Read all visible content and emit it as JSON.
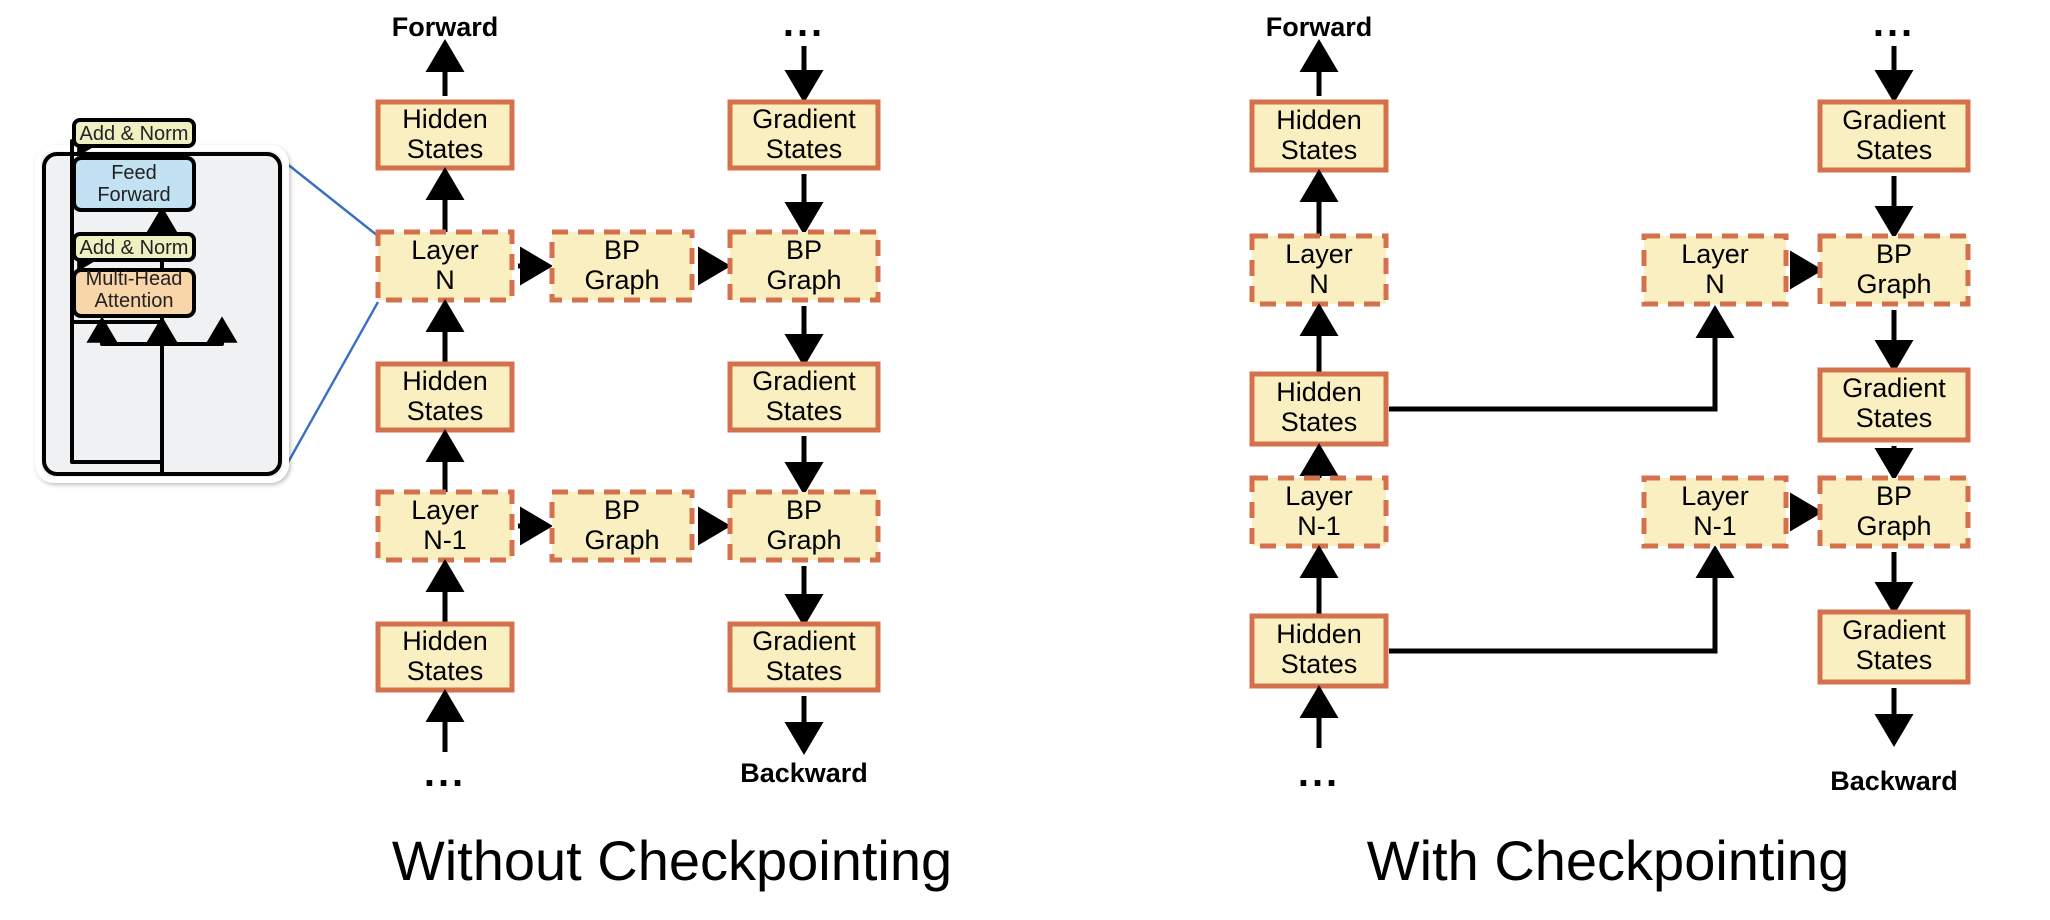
{
  "colors": {
    "box_fill": "#FAEFC0",
    "box_border": "#D4714C",
    "arrow": "#000000",
    "connector_blue": "#3B6FC4",
    "inset_bg": "#F0F1F2",
    "inset_border": "#000000",
    "addnorm_fill": "#EFF0C2",
    "feedforward_fill": "#C2E1F2",
    "attention_fill": "#F9D5AA"
  },
  "labels": {
    "hidden_states": "Hidden States",
    "gradient_states": "Gradient States",
    "layer_n": "Layer N",
    "layer_n_minus_1": "Layer N-1",
    "bp_graph": "BP Graph",
    "forward": "Forward",
    "backward": "Backward",
    "ellipsis": "..."
  },
  "inset": {
    "add_norm_top": "Add & Norm",
    "feed_forward_l1": "Feed",
    "feed_forward_l2": "Forward",
    "add_norm_bottom": "Add & Norm",
    "attention_l1": "Multi-Head",
    "attention_l2": "Attention"
  },
  "panels": [
    {
      "id": "without-checkpointing",
      "caption": "Without Checkpointing",
      "boxes": [
        {
          "name": "hidden-states-top",
          "text1": "Hidden",
          "text2": "States",
          "style": "solid"
        },
        {
          "name": "layer-n",
          "text1": "Layer",
          "text2": "N",
          "style": "dashed"
        },
        {
          "name": "hidden-states-mid",
          "text1": "Hidden",
          "text2": "States",
          "style": "solid"
        },
        {
          "name": "layer-n-minus-1",
          "text1": "Layer",
          "text2": "N-1",
          "style": "dashed"
        },
        {
          "name": "hidden-states-bottom",
          "text1": "Hidden",
          "text2": "States",
          "style": "solid"
        },
        {
          "name": "bp-graph-mid-n",
          "text1": "BP",
          "text2": "Graph",
          "style": "dashed"
        },
        {
          "name": "bp-graph-mid-n-1",
          "text1": "BP",
          "text2": "Graph",
          "style": "dashed"
        },
        {
          "name": "gradient-states-top",
          "text1": "Gradient",
          "text2": "States",
          "style": "solid"
        },
        {
          "name": "bp-graph-right-n",
          "text1": "BP",
          "text2": "Graph",
          "style": "dashed"
        },
        {
          "name": "gradient-states-mid",
          "text1": "Gradient",
          "text2": "States",
          "style": "solid"
        },
        {
          "name": "bp-graph-right-n-1",
          "text1": "BP",
          "text2": "Graph",
          "style": "dashed"
        },
        {
          "name": "gradient-states-bottom",
          "text1": "Gradient",
          "text2": "States",
          "style": "solid"
        }
      ]
    },
    {
      "id": "with-checkpointing",
      "caption": "With Checkpointing",
      "boxes": [
        {
          "name": "hidden-states-top",
          "text1": "Hidden",
          "text2": "States",
          "style": "solid"
        },
        {
          "name": "layer-n",
          "text1": "Layer",
          "text2": "N",
          "style": "dashed"
        },
        {
          "name": "hidden-states-mid",
          "text1": "Hidden",
          "text2": "States",
          "style": "solid"
        },
        {
          "name": "layer-n-minus-1",
          "text1": "Layer",
          "text2": "N-1",
          "style": "dashed"
        },
        {
          "name": "hidden-states-bottom",
          "text1": "Hidden",
          "text2": "States",
          "style": "solid"
        },
        {
          "name": "recompute-layer-n",
          "text1": "Layer",
          "text2": "N",
          "style": "dashed"
        },
        {
          "name": "recompute-layer-n-1",
          "text1": "Layer",
          "text2": "N-1",
          "style": "dashed"
        },
        {
          "name": "gradient-states-top",
          "text1": "Gradient",
          "text2": "States",
          "style": "solid"
        },
        {
          "name": "bp-graph-n",
          "text1": "BP",
          "text2": "Graph",
          "style": "dashed"
        },
        {
          "name": "gradient-states-mid",
          "text1": "Gradient",
          "text2": "States",
          "style": "solid"
        },
        {
          "name": "bp-graph-n-1",
          "text1": "BP",
          "text2": "Graph",
          "style": "dashed"
        },
        {
          "name": "gradient-states-bottom",
          "text1": "Gradient",
          "text2": "States",
          "style": "solid"
        }
      ]
    }
  ]
}
